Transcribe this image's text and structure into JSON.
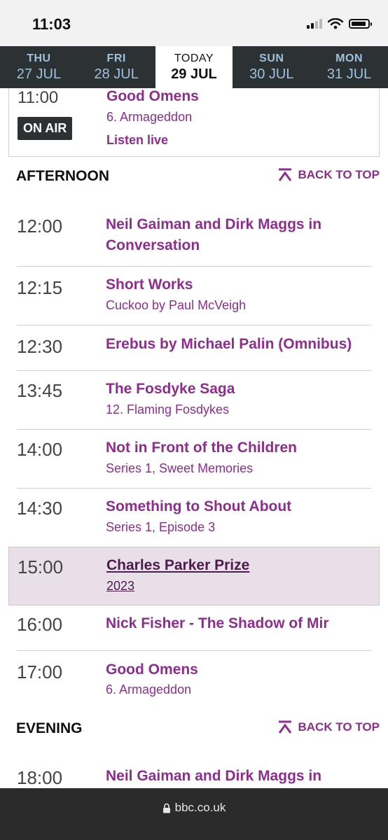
{
  "status": {
    "time": "11:03"
  },
  "days": [
    {
      "name": "THU",
      "date": "27 JUL"
    },
    {
      "name": "FRI",
      "date": "28 JUL"
    },
    {
      "name": "TODAY",
      "date": "29 JUL"
    },
    {
      "name": "SUN",
      "date": "30 JUL"
    },
    {
      "name": "MON",
      "date": "31 JUL"
    }
  ],
  "on_air": {
    "time": "11:00",
    "badge": "ON AIR",
    "title": "Good Omens",
    "subtitle": "6. Armageddon",
    "listen": "Listen live"
  },
  "sections": {
    "afternoon": {
      "title": "AFTERNOON",
      "back": "BACK TO TOP"
    },
    "evening": {
      "title": "EVENING",
      "back": "BACK TO TOP"
    }
  },
  "programmes": [
    {
      "time": "12:00",
      "title": "Neil Gaiman and Dirk Maggs in Conversation",
      "subtitle": ""
    },
    {
      "time": "12:15",
      "title": "Short Works",
      "subtitle": "Cuckoo by Paul McVeigh"
    },
    {
      "time": "12:30",
      "title": "Erebus by Michael Palin (Omnibus)",
      "subtitle": ""
    },
    {
      "time": "13:45",
      "title": "The Fosdyke Saga",
      "subtitle": "12. Flaming Fosdykes"
    },
    {
      "time": "14:00",
      "title": "Not in Front of the Children",
      "subtitle": "Series 1, Sweet Memories"
    },
    {
      "time": "14:30",
      "title": "Something to Shout About",
      "subtitle": "Series 1, Episode 3"
    },
    {
      "time": "15:00",
      "title": "Charles Parker Prize",
      "subtitle": "2023"
    },
    {
      "time": "16:00",
      "title": "Nick Fisher - The Shadow of Mir",
      "subtitle": ""
    },
    {
      "time": "17:00",
      "title": "Good Omens",
      "subtitle": "6. Armageddon"
    }
  ],
  "evening_programmes": [
    {
      "time": "18:00",
      "title": "Neil Gaiman and Dirk Maggs in",
      "subtitle": ""
    }
  ],
  "url_bar": {
    "url": "bbc.co.uk"
  },
  "colors": {
    "accent": "#8f2c8f",
    "tab_bg": "#2c3133",
    "highlight": "#e9dfe9"
  }
}
